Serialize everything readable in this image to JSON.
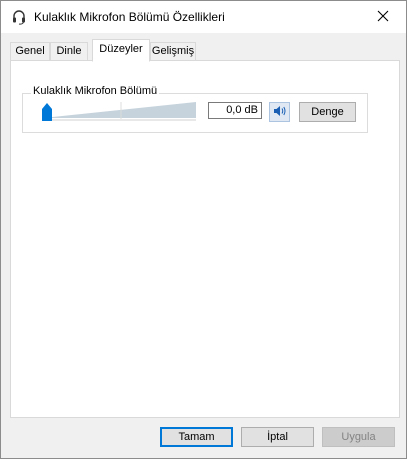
{
  "window": {
    "title": "Kulaklık Mikrofon Bölümü Özellikleri"
  },
  "icons": {
    "app": "headset-icon",
    "close": "close-icon",
    "speaker": "speaker-icon"
  },
  "tabs": [
    {
      "label": "Genel",
      "active": false
    },
    {
      "label": "Dinle",
      "active": false
    },
    {
      "label": "Düzeyler",
      "active": true
    },
    {
      "label": "Gelişmiş",
      "active": false
    }
  ],
  "levels": {
    "group_label": "Kulaklık Mikrofon Bölümü",
    "level_fraction": 0,
    "db_value": "0,0 dB",
    "balance_label": "Denge"
  },
  "footer": {
    "ok_label": "Tamam",
    "cancel_label": "İptal",
    "apply_label": "Uygula"
  },
  "colors": {
    "accent": "#0078d7",
    "slider_thumb": "#0078d7",
    "track": "#c6d3dc"
  }
}
